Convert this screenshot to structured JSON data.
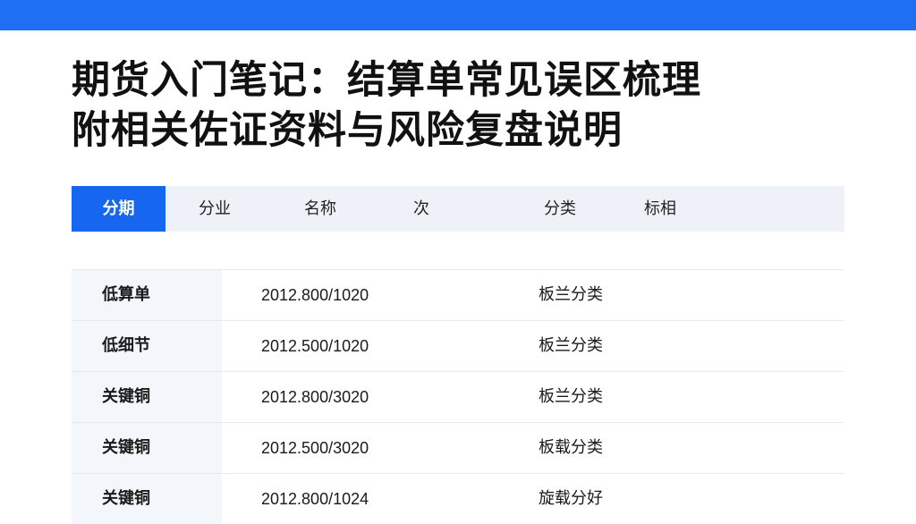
{
  "header": {
    "accent_color": "#1e6ff2"
  },
  "title": {
    "line1": "期货入门笔记：结算单常见误区梳理",
    "line2": "附相关佐证资料与风险复盘说明"
  },
  "tabs": [
    {
      "label": "分期",
      "active": true
    },
    {
      "label": "分业"
    },
    {
      "label": "名称"
    },
    {
      "label": "次"
    },
    {
      "label": "分类"
    },
    {
      "label": "标相"
    }
  ],
  "table": {
    "rows": [
      {
        "name": "低算单",
        "value": "2012.800/1020",
        "category": "板兰分类"
      },
      {
        "name": "低细节",
        "value": "2012.500/1020",
        "category": "板兰分类"
      },
      {
        "name": "关键铜",
        "value": "2012.800/3020",
        "category": "板兰分类"
      },
      {
        "name": "关键铜",
        "value": "2012.500/3020",
        "category": "板载分类"
      },
      {
        "name": "关键铜",
        "value": "2012.800/1024",
        "category": "旋载分好"
      }
    ]
  }
}
